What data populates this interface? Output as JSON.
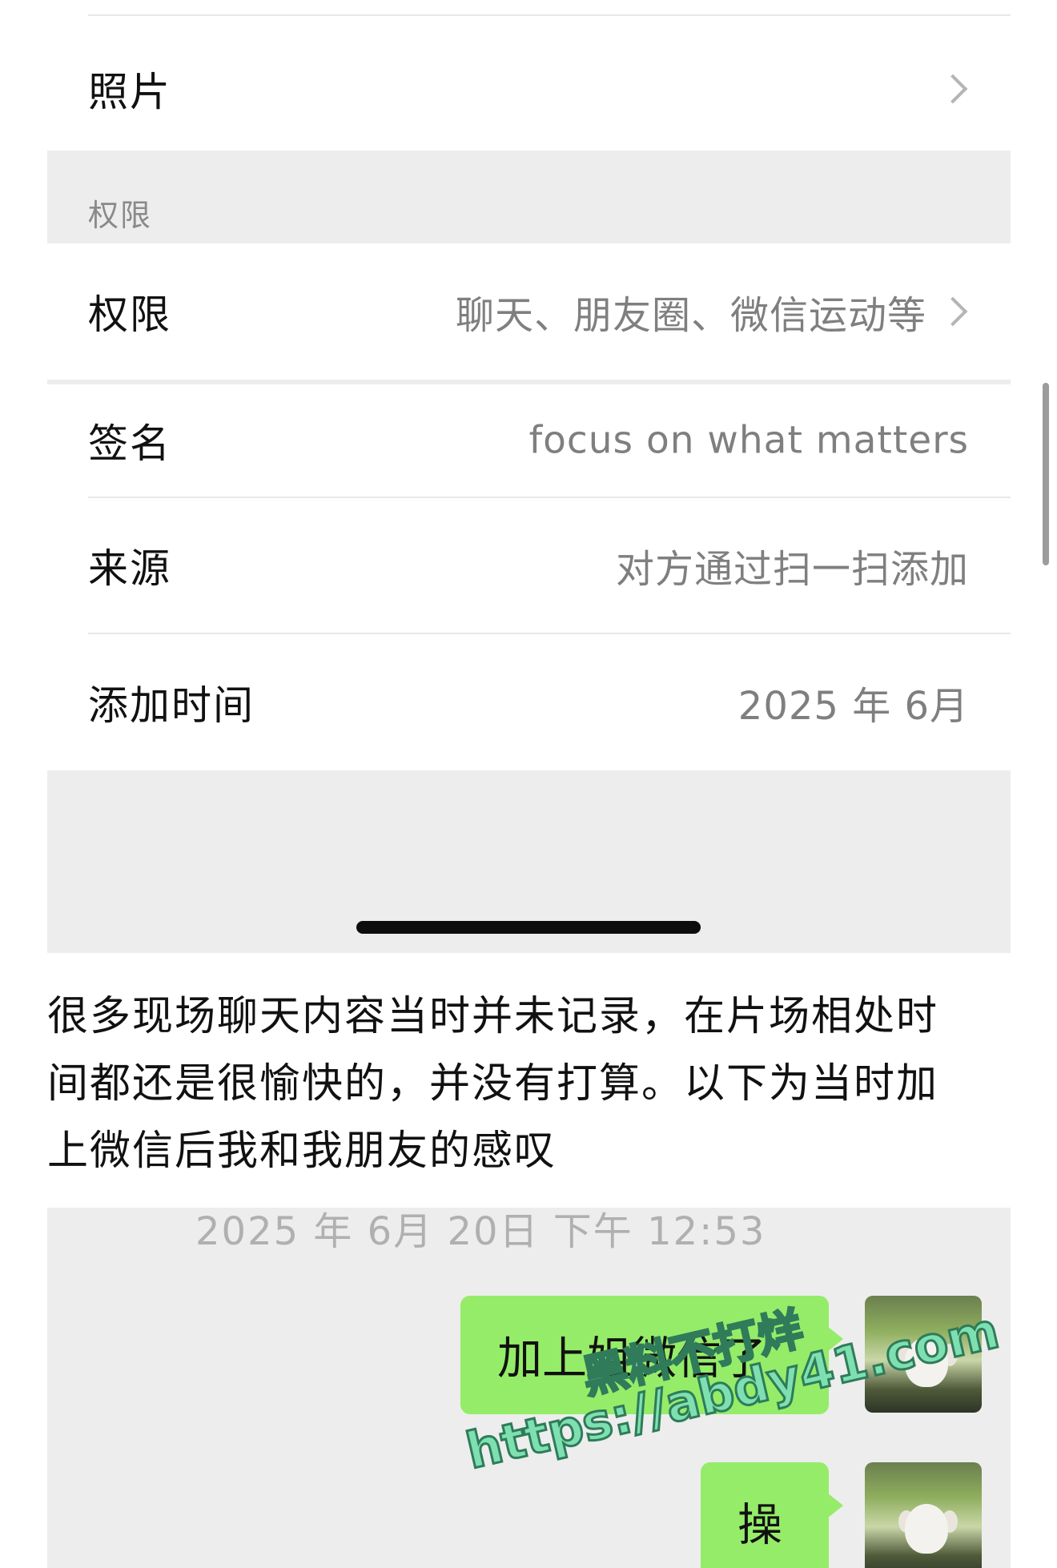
{
  "profile": {
    "photos_label": "照片",
    "permission_section_title": "权限",
    "permission_label": "权限",
    "permission_value": "聊天、朋友圈、微信运动等",
    "signature_label": "签名",
    "signature_value": "focus on what matters",
    "source_label": "来源",
    "source_value": "对方通过扫一扫添加",
    "added_time_label": "添加时间",
    "added_time_value": "2025 年 6月"
  },
  "caption": {
    "lines": [
      "很多现场聊天内容当时并未记录，在片场相处时",
      "间都还是很愉快的，并没有打算。以下为当时加",
      "上微信后我和我朋友的感叹"
    ]
  },
  "chat": {
    "timestamp": "2025 年 6月 20日 下午 12:53",
    "messages": [
      {
        "text": "加上姐微信了",
        "from": "self"
      },
      {
        "text": "操",
        "from": "self"
      }
    ]
  },
  "watermark": {
    "line1": "黑料不打烊",
    "line2": "https://abdy41.com"
  },
  "colors": {
    "bubble": "#95ec69",
    "page_gray": "#ededed",
    "secondary_text": "#7f7f7f"
  }
}
